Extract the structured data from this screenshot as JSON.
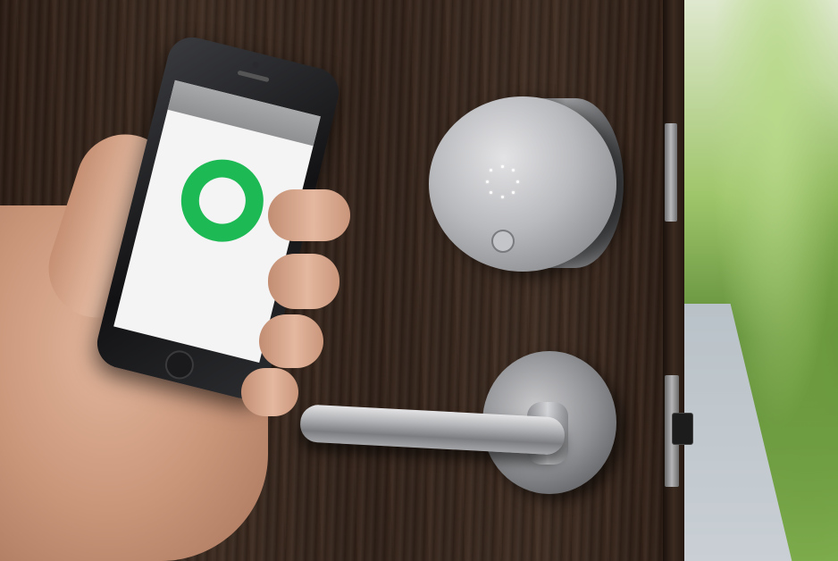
{
  "scene": {
    "subject": "smart-lock-door-phone",
    "colors": {
      "door_wood": "#35261c",
      "lock_metal": "#b9babd",
      "phone_status_ring": "#1db954",
      "foliage": "#7fae4e"
    }
  },
  "phone": {
    "app_header": "",
    "status_label": "",
    "footer_label": ""
  },
  "lock": {
    "indicator_led_count": 8,
    "state_icon": "unlocked-ring-icon"
  }
}
